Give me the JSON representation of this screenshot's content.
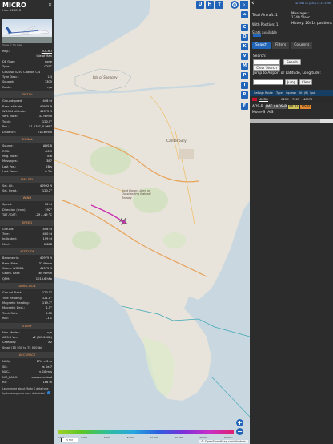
{
  "aircraft": {
    "callsign": "MICRO",
    "hex_label": "Hex:",
    "hex": "424818",
    "photo_credit": "Image © Tim Lowe",
    "reg_label": "Reg.:",
    "reg": "M-ICRO",
    "country": "Isle of Man",
    "db_flags_label": "DB flags:",
    "db_flags": "none",
    "type_label": "Type:",
    "type": "C25C",
    "type_full": "CESSNA 525C Citation CJ4",
    "typedesc_label": "Type Desc.:",
    "typedesc": "L2J",
    "squawk_label": "Squawk:",
    "squawk": "7305",
    "route_label": "Route:",
    "route": "n/a"
  },
  "sections": {
    "spatial": "SPATIAL",
    "signal": "SIGNAL",
    "fms": "FMS SEL",
    "wind": "WIND",
    "speed": "SPEED",
    "altitude": "ALTITUDE",
    "direction": "DIRECTION",
    "stuff": "STUFF",
    "accuracy": "ACCURACY"
  },
  "spatial": [
    {
      "k": "Groundspeed:",
      "v": "446 kt"
    },
    {
      "k": "Baro. altitude:",
      "v": "40975 ft"
    },
    {
      "k": "WGS84 altitude:",
      "v": "41375 ft"
    },
    {
      "k": "Vert. Rate:",
      "v": "32 ft/min"
    },
    {
      "k": "Track:",
      "v": "120.5°"
    },
    {
      "k": "Pos.:",
      "v": "51.176°, 0.968°"
    },
    {
      "k": "Distance:",
      "v": "218.6 nmi"
    }
  ],
  "signal": [
    {
      "k": "Source:",
      "v": "ADS-B"
    },
    {
      "k": "RSSI:",
      "v": "-26.9"
    },
    {
      "k": "Msg. Rate:",
      "v": "8.6"
    },
    {
      "k": "Messages:",
      "v": "387"
    },
    {
      "k": "Last Pos.:",
      "v": "28 s"
    },
    {
      "k": "Last Seen:",
      "v": "0.7 s"
    }
  ],
  "fms": [
    {
      "k": "Sel. Alt.:",
      "v": "40992 ft"
    },
    {
      "k": "Sel. Head.:",
      "v": "120.2°"
    }
  ],
  "wind": [
    {
      "k": "Speed:",
      "v": "36 kt"
    },
    {
      "k": "Direction (from):",
      "v": "292°"
    },
    {
      "k": "TAT / OAT:",
      "v": "-29 / -49 °C"
    }
  ],
  "speed": [
    {
      "k": "Ground:",
      "v": "446 kt"
    },
    {
      "k": "True:",
      "v": "400 kt"
    },
    {
      "k": "Indicated:",
      "v": "199 kt"
    },
    {
      "k": "Mach:",
      "v": "0.688"
    }
  ],
  "altitude": [
    {
      "k": "Barometric:",
      "v": "40975 ft"
    },
    {
      "k": "Baro. Rate:",
      "v": "32 ft/min"
    },
    {
      "k": "Geom. WGS84:",
      "v": "41375 ft"
    },
    {
      "k": "Geom. Rate:",
      "v": "-64 ft/min"
    },
    {
      "k": "QNH:",
      "v": "1013.6 hPa"
    }
  ],
  "direction": [
    {
      "k": "Ground Track:",
      "v": "120.5°"
    },
    {
      "k": "True Heading:",
      "v": "121.0°"
    },
    {
      "k": "Magnetic Heading:",
      "v": "119.7°"
    },
    {
      "k": "Magnetic Decl.:",
      "v": "1.5°"
    },
    {
      "k": "Track Rate:",
      "v": "0.00"
    },
    {
      "k": "Roll:",
      "v": "-1.1"
    }
  ],
  "stuff": [
    {
      "k": "Nav. Modes:",
      "v": "n/a"
    },
    {
      "k": "ADS-B Ver.:",
      "v": "v2 (DO-260B)"
    },
    {
      "k": "Category:",
      "v": "A2"
    },
    {
      "k": "Small (15 500 to 75 000 lb)",
      "v": ""
    }
  ],
  "accuracy": [
    {
      "k": "NACₚ:",
      "v": "EPU < 3 m"
    },
    {
      "k": "SIL:",
      "v": "≤ 1e-7"
    },
    {
      "k": "NACᵥ:",
      "v": "< 10 m/s"
    },
    {
      "k": "NIC_BARO:",
      "v": "cross-checked"
    },
    {
      "k": "Rc:",
      "v": "186 m"
    }
  ],
  "footnote": "Learn more about Mode S data type by hovering over each data label.",
  "map": {
    "buttons": [
      "U",
      "H",
      "T"
    ],
    "side_buttons": [
      "C",
      "O",
      "K",
      "V",
      "M",
      "P",
      "I",
      "R"
    ],
    "labels": {
      "canterbury": "Canterbury",
      "kent_downs": "Kent Downs Area of Outstanding Natural Beauty",
      "isle_of_sheppey": "Isle of Sheppey"
    },
    "alt_ticks": [
      "2 000",
      "4 000",
      "6 000",
      "8 000",
      "10 000",
      "20 000",
      "30 000",
      "40 000+"
    ],
    "scale": "5 NM",
    "attribution": "© OpenStreetMap contributors."
  },
  "stats": {
    "total_label": "Total Aircraft:",
    "total": "1",
    "with_pos_label": "With Position:",
    "with_pos": "1",
    "messages_label": "Messages:",
    "messages": "1340.5/sec",
    "history_label": "History:",
    "history": "26414 positions",
    "stats_label": "Stats available",
    "version": "tar1090 on github (3.14.1730)"
  },
  "tabs": [
    "Search",
    "Filters",
    "Columns"
  ],
  "search": {
    "label": "Search:",
    "button": "Search",
    "clear": "Clear Search",
    "jump_label": "Jump to Airport or Latitude, Longitude:",
    "jump_btn": "Jump",
    "clear_btn": "Clear"
  },
  "table": {
    "headers": [
      "Callsign",
      "Route",
      "Type",
      "Squawk",
      "Alt. (ft)",
      "Spd."
    ],
    "row": {
      "callsign": "MICRO",
      "route": "",
      "type": "C25C",
      "squawk": "7305",
      "alt": "40975"
    }
  },
  "tags": [
    {
      "text": "ADS-B",
      "style": "none"
    },
    {
      "text": "UAT / ADS-R",
      "style": "gray"
    },
    {
      "text": "MLAT",
      "style": "yel"
    },
    {
      "text": "TIS-B",
      "style": "ora"
    },
    {
      "text": "Mode-S",
      "style": "none"
    },
    {
      "text": "AIS",
      "style": "none"
    }
  ],
  "colors": {
    "accent": "#2164b8",
    "section_text": "#f39a5a",
    "aircraft": "#c930b0",
    "map_land": "#f2efe9",
    "map_sea": "#aad3df"
  }
}
